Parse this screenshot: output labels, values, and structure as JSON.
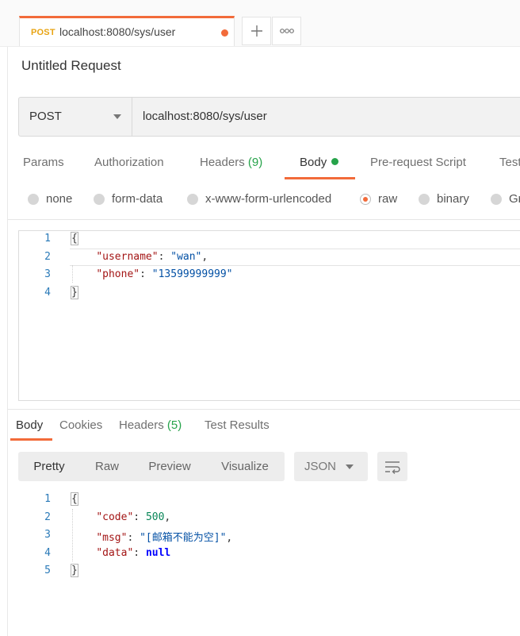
{
  "tab": {
    "method": "POST",
    "url": "localhost:8080/sys/user"
  },
  "title": "Untitled Request",
  "urlbar": {
    "method": "POST",
    "url": "localhost:8080/sys/user"
  },
  "request_tabs": {
    "params": "Params",
    "authorization": "Authorization",
    "headers": "Headers",
    "headers_count": "(9)",
    "body": "Body",
    "prerequest": "Pre-request Script",
    "tests": "Tests"
  },
  "body_types": {
    "none": "none",
    "form_data": "form-data",
    "urlencoded": "x-www-form-urlencoded",
    "raw": "raw",
    "binary": "binary",
    "graphql": "GraphQL",
    "selected": "raw"
  },
  "request_body": {
    "line_numbers": [
      "1",
      "2",
      "3",
      "4"
    ],
    "open": "{",
    "close": "}",
    "k1": "\"username\"",
    "v1": "\"wan\"",
    "k2": "\"phone\"",
    "v2": "\"13599999999\""
  },
  "response_tabs": {
    "body": "Body",
    "cookies": "Cookies",
    "headers": "Headers",
    "headers_count": "(5)",
    "test_results": "Test Results"
  },
  "response_view": {
    "pretty": "Pretty",
    "raw": "Raw",
    "preview": "Preview",
    "visualize": "Visualize",
    "format": "JSON"
  },
  "response_body": {
    "line_numbers": [
      "1",
      "2",
      "3",
      "4",
      "5"
    ],
    "open": "{",
    "close": "}",
    "k1": "\"code\"",
    "v1": "500",
    "k2": "\"msg\"",
    "v2": "\"[邮箱不能为空]\"",
    "k3": "\"data\"",
    "v3": "null"
  },
  "colors": {
    "accent": "#f26b3a",
    "success": "#26a34a",
    "post_method": "#e8a413"
  },
  "icons": {
    "add_tab": "plus-icon",
    "more_tabs": "more-icon",
    "wrap": "wrap-lines-icon"
  }
}
